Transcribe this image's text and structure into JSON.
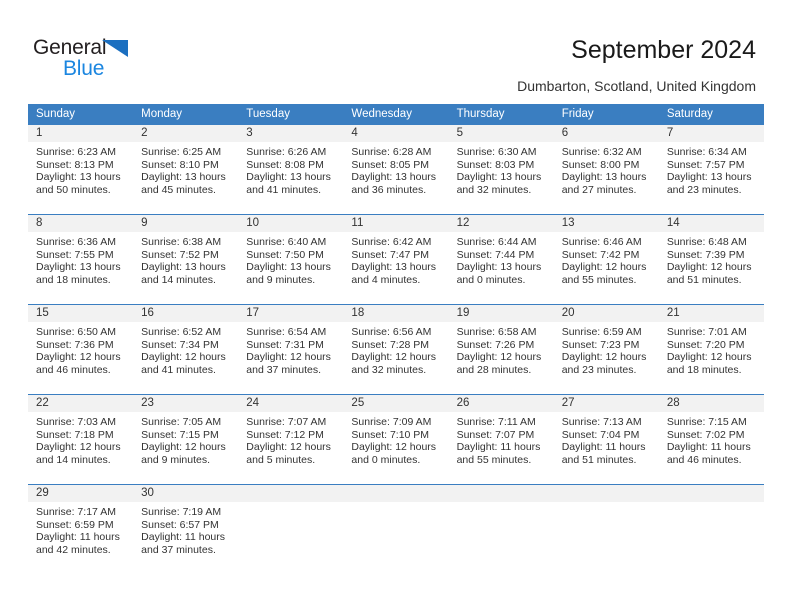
{
  "brand": {
    "name_part1": "General",
    "name_part2": "Blue",
    "triangle_icon": "triangle-icon",
    "accent_blue": "#1b86e0",
    "dark": "#231f20"
  },
  "header": {
    "title": "September 2024",
    "subtitle": "Dumbarton, Scotland, United Kingdom"
  },
  "theme": {
    "header_bar": "#3a7ec1",
    "day_number_bg": "#f2f2f2",
    "text": "#333333"
  },
  "weekdays": [
    "Sunday",
    "Monday",
    "Tuesday",
    "Wednesday",
    "Thursday",
    "Friday",
    "Saturday"
  ],
  "weeks": [
    [
      {
        "day": "1",
        "sunrise": "Sunrise: 6:23 AM",
        "sunset": "Sunset: 8:13 PM",
        "daylight1": "Daylight: 13 hours",
        "daylight2": "and 50 minutes."
      },
      {
        "day": "2",
        "sunrise": "Sunrise: 6:25 AM",
        "sunset": "Sunset: 8:10 PM",
        "daylight1": "Daylight: 13 hours",
        "daylight2": "and 45 minutes."
      },
      {
        "day": "3",
        "sunrise": "Sunrise: 6:26 AM",
        "sunset": "Sunset: 8:08 PM",
        "daylight1": "Daylight: 13 hours",
        "daylight2": "and 41 minutes."
      },
      {
        "day": "4",
        "sunrise": "Sunrise: 6:28 AM",
        "sunset": "Sunset: 8:05 PM",
        "daylight1": "Daylight: 13 hours",
        "daylight2": "and 36 minutes."
      },
      {
        "day": "5",
        "sunrise": "Sunrise: 6:30 AM",
        "sunset": "Sunset: 8:03 PM",
        "daylight1": "Daylight: 13 hours",
        "daylight2": "and 32 minutes."
      },
      {
        "day": "6",
        "sunrise": "Sunrise: 6:32 AM",
        "sunset": "Sunset: 8:00 PM",
        "daylight1": "Daylight: 13 hours",
        "daylight2": "and 27 minutes."
      },
      {
        "day": "7",
        "sunrise": "Sunrise: 6:34 AM",
        "sunset": "Sunset: 7:57 PM",
        "daylight1": "Daylight: 13 hours",
        "daylight2": "and 23 minutes."
      }
    ],
    [
      {
        "day": "8",
        "sunrise": "Sunrise: 6:36 AM",
        "sunset": "Sunset: 7:55 PM",
        "daylight1": "Daylight: 13 hours",
        "daylight2": "and 18 minutes."
      },
      {
        "day": "9",
        "sunrise": "Sunrise: 6:38 AM",
        "sunset": "Sunset: 7:52 PM",
        "daylight1": "Daylight: 13 hours",
        "daylight2": "and 14 minutes."
      },
      {
        "day": "10",
        "sunrise": "Sunrise: 6:40 AM",
        "sunset": "Sunset: 7:50 PM",
        "daylight1": "Daylight: 13 hours",
        "daylight2": "and 9 minutes."
      },
      {
        "day": "11",
        "sunrise": "Sunrise: 6:42 AM",
        "sunset": "Sunset: 7:47 PM",
        "daylight1": "Daylight: 13 hours",
        "daylight2": "and 4 minutes."
      },
      {
        "day": "12",
        "sunrise": "Sunrise: 6:44 AM",
        "sunset": "Sunset: 7:44 PM",
        "daylight1": "Daylight: 13 hours",
        "daylight2": "and 0 minutes."
      },
      {
        "day": "13",
        "sunrise": "Sunrise: 6:46 AM",
        "sunset": "Sunset: 7:42 PM",
        "daylight1": "Daylight: 12 hours",
        "daylight2": "and 55 minutes."
      },
      {
        "day": "14",
        "sunrise": "Sunrise: 6:48 AM",
        "sunset": "Sunset: 7:39 PM",
        "daylight1": "Daylight: 12 hours",
        "daylight2": "and 51 minutes."
      }
    ],
    [
      {
        "day": "15",
        "sunrise": "Sunrise: 6:50 AM",
        "sunset": "Sunset: 7:36 PM",
        "daylight1": "Daylight: 12 hours",
        "daylight2": "and 46 minutes."
      },
      {
        "day": "16",
        "sunrise": "Sunrise: 6:52 AM",
        "sunset": "Sunset: 7:34 PM",
        "daylight1": "Daylight: 12 hours",
        "daylight2": "and 41 minutes."
      },
      {
        "day": "17",
        "sunrise": "Sunrise: 6:54 AM",
        "sunset": "Sunset: 7:31 PM",
        "daylight1": "Daylight: 12 hours",
        "daylight2": "and 37 minutes."
      },
      {
        "day": "18",
        "sunrise": "Sunrise: 6:56 AM",
        "sunset": "Sunset: 7:28 PM",
        "daylight1": "Daylight: 12 hours",
        "daylight2": "and 32 minutes."
      },
      {
        "day": "19",
        "sunrise": "Sunrise: 6:58 AM",
        "sunset": "Sunset: 7:26 PM",
        "daylight1": "Daylight: 12 hours",
        "daylight2": "and 28 minutes."
      },
      {
        "day": "20",
        "sunrise": "Sunrise: 6:59 AM",
        "sunset": "Sunset: 7:23 PM",
        "daylight1": "Daylight: 12 hours",
        "daylight2": "and 23 minutes."
      },
      {
        "day": "21",
        "sunrise": "Sunrise: 7:01 AM",
        "sunset": "Sunset: 7:20 PM",
        "daylight1": "Daylight: 12 hours",
        "daylight2": "and 18 minutes."
      }
    ],
    [
      {
        "day": "22",
        "sunrise": "Sunrise: 7:03 AM",
        "sunset": "Sunset: 7:18 PM",
        "daylight1": "Daylight: 12 hours",
        "daylight2": "and 14 minutes."
      },
      {
        "day": "23",
        "sunrise": "Sunrise: 7:05 AM",
        "sunset": "Sunset: 7:15 PM",
        "daylight1": "Daylight: 12 hours",
        "daylight2": "and 9 minutes."
      },
      {
        "day": "24",
        "sunrise": "Sunrise: 7:07 AM",
        "sunset": "Sunset: 7:12 PM",
        "daylight1": "Daylight: 12 hours",
        "daylight2": "and 5 minutes."
      },
      {
        "day": "25",
        "sunrise": "Sunrise: 7:09 AM",
        "sunset": "Sunset: 7:10 PM",
        "daylight1": "Daylight: 12 hours",
        "daylight2": "and 0 minutes."
      },
      {
        "day": "26",
        "sunrise": "Sunrise: 7:11 AM",
        "sunset": "Sunset: 7:07 PM",
        "daylight1": "Daylight: 11 hours",
        "daylight2": "and 55 minutes."
      },
      {
        "day": "27",
        "sunrise": "Sunrise: 7:13 AM",
        "sunset": "Sunset: 7:04 PM",
        "daylight1": "Daylight: 11 hours",
        "daylight2": "and 51 minutes."
      },
      {
        "day": "28",
        "sunrise": "Sunrise: 7:15 AM",
        "sunset": "Sunset: 7:02 PM",
        "daylight1": "Daylight: 11 hours",
        "daylight2": "and 46 minutes."
      }
    ],
    [
      {
        "day": "29",
        "sunrise": "Sunrise: 7:17 AM",
        "sunset": "Sunset: 6:59 PM",
        "daylight1": "Daylight: 11 hours",
        "daylight2": "and 42 minutes."
      },
      {
        "day": "30",
        "sunrise": "Sunrise: 7:19 AM",
        "sunset": "Sunset: 6:57 PM",
        "daylight1": "Daylight: 11 hours",
        "daylight2": "and 37 minutes."
      },
      {
        "day": "",
        "sunrise": "",
        "sunset": "",
        "daylight1": "",
        "daylight2": ""
      },
      {
        "day": "",
        "sunrise": "",
        "sunset": "",
        "daylight1": "",
        "daylight2": ""
      },
      {
        "day": "",
        "sunrise": "",
        "sunset": "",
        "daylight1": "",
        "daylight2": ""
      },
      {
        "day": "",
        "sunrise": "",
        "sunset": "",
        "daylight1": "",
        "daylight2": ""
      },
      {
        "day": "",
        "sunrise": "",
        "sunset": "",
        "daylight1": "",
        "daylight2": ""
      }
    ]
  ]
}
